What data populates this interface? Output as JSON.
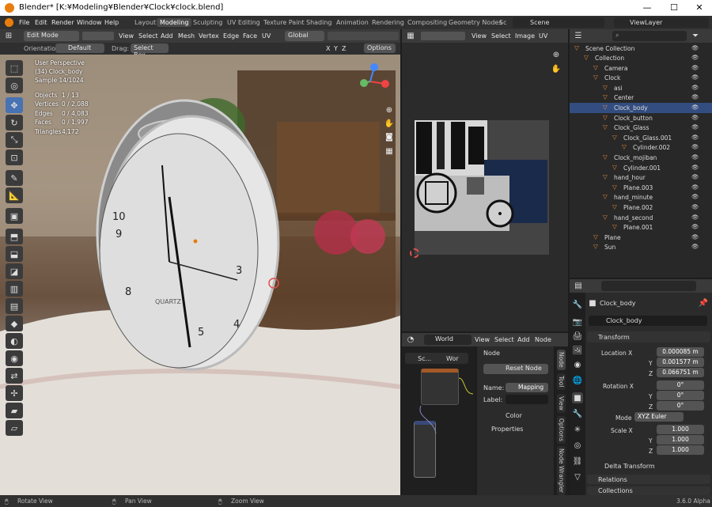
{
  "window": {
    "title": "Blender* [K:¥Modeling¥Blender¥Clock¥clock.blend]",
    "minimize": "—",
    "maximize": "☐",
    "close": "✕"
  },
  "menu": [
    "File",
    "Edit",
    "Render",
    "Window",
    "Help"
  ],
  "workspaces": [
    "Layout",
    "Modeling",
    "Sculpting",
    "UV Editing",
    "Texture Paint",
    "Shading",
    "Animation",
    "Rendering",
    "Compositing",
    "Geometry Nodes",
    "Sc"
  ],
  "scene": "Scene",
  "view_layer": "ViewLayer",
  "viewport": {
    "mode": "Edit Mode",
    "menus": [
      "View",
      "Select",
      "Add",
      "Mesh",
      "Vertex",
      "Edge",
      "Face",
      "UV"
    ],
    "transform_orientation": "Global",
    "orientation_label": "Orientation:",
    "orientation_value": "Default",
    "drag_label": "Drag:",
    "drag_value": "Select Box",
    "axes": [
      "X",
      "Y",
      "Z"
    ],
    "options": "Options",
    "overlay": {
      "view": "User Perspective",
      "object": "(34) Clock_body",
      "sample": "Sample 14/1024",
      "stats": [
        {
          "k": "Objects",
          "v": "1 / 13"
        },
        {
          "k": "Vertices",
          "v": "0 / 2,088"
        },
        {
          "k": "Edges",
          "v": "0 / 4,083"
        },
        {
          "k": "Faces",
          "v": "0 / 1,997"
        },
        {
          "k": "Triangles",
          "v": "4,172"
        }
      ]
    },
    "clock_numbers": [
      "10",
      "9",
      "8",
      "4",
      "3",
      "5"
    ],
    "brand": "QUARTZ"
  },
  "uv_editor": {
    "menus": [
      "View",
      "Select",
      "Image",
      "UV"
    ]
  },
  "node_editor": {
    "world": "World",
    "menus": [
      "View",
      "Select",
      "Add",
      "Node"
    ],
    "panel": "Node",
    "reset": "Reset Node",
    "name_label": "Name:",
    "name_value": "Mapping",
    "label_label": "Label:",
    "color": "Color",
    "properties": "Properties",
    "tabs": [
      "Node",
      "Tool",
      "View",
      "Options",
      "Node Wrangler"
    ],
    "node_a": "Sc...",
    "node_b": "Wor"
  },
  "outliner": {
    "root": "Scene Collection",
    "items": [
      {
        "name": "Collection",
        "indent": 1
      },
      {
        "name": "Camera",
        "indent": 2
      },
      {
        "name": "Clock",
        "indent": 2
      },
      {
        "name": "asi",
        "indent": 3
      },
      {
        "name": "Center",
        "indent": 3
      },
      {
        "name": "Clock_body",
        "indent": 3
      },
      {
        "name": "Clock_button",
        "indent": 3
      },
      {
        "name": "Clock_Glass",
        "indent": 3
      },
      {
        "name": "Clock_Glass.001",
        "indent": 4
      },
      {
        "name": "Cylinder.002",
        "indent": 5
      },
      {
        "name": "Clock_mojiban",
        "indent": 3
      },
      {
        "name": "Cylinder.001",
        "indent": 4
      },
      {
        "name": "hand_hour",
        "indent": 3
      },
      {
        "name": "Plane.003",
        "indent": 4
      },
      {
        "name": "hand_minute",
        "indent": 3
      },
      {
        "name": "Plane.002",
        "indent": 4
      },
      {
        "name": "hand_second",
        "indent": 3
      },
      {
        "name": "Plane.001",
        "indent": 4
      },
      {
        "name": "Plane",
        "indent": 2
      },
      {
        "name": "Sun",
        "indent": 2
      }
    ]
  },
  "properties": {
    "object": "Clock_body",
    "object_field": "Clock_body",
    "transform": "Transform",
    "location": [
      {
        "k": "Location X",
        "v": "0.000085 m"
      },
      {
        "k": "Y",
        "v": "0.001577 m"
      },
      {
        "k": "Z",
        "v": "0.066751 m"
      }
    ],
    "rotation": [
      {
        "k": "Rotation X",
        "v": "0°"
      },
      {
        "k": "Y",
        "v": "0°"
      },
      {
        "k": "Z",
        "v": "0°"
      }
    ],
    "mode_label": "Mode",
    "mode": "XYZ Euler",
    "scale": [
      {
        "k": "Scale X",
        "v": "1.000"
      },
      {
        "k": "Y",
        "v": "1.000"
      },
      {
        "k": "Z",
        "v": "1.000"
      }
    ],
    "delta": "Delta Transform",
    "relations": "Relations",
    "collections": "Collections"
  },
  "statusbar": {
    "items": [
      "Rotate View",
      "Pan View",
      "Zoom View"
    ],
    "version": "3.6.0 Alpha"
  }
}
